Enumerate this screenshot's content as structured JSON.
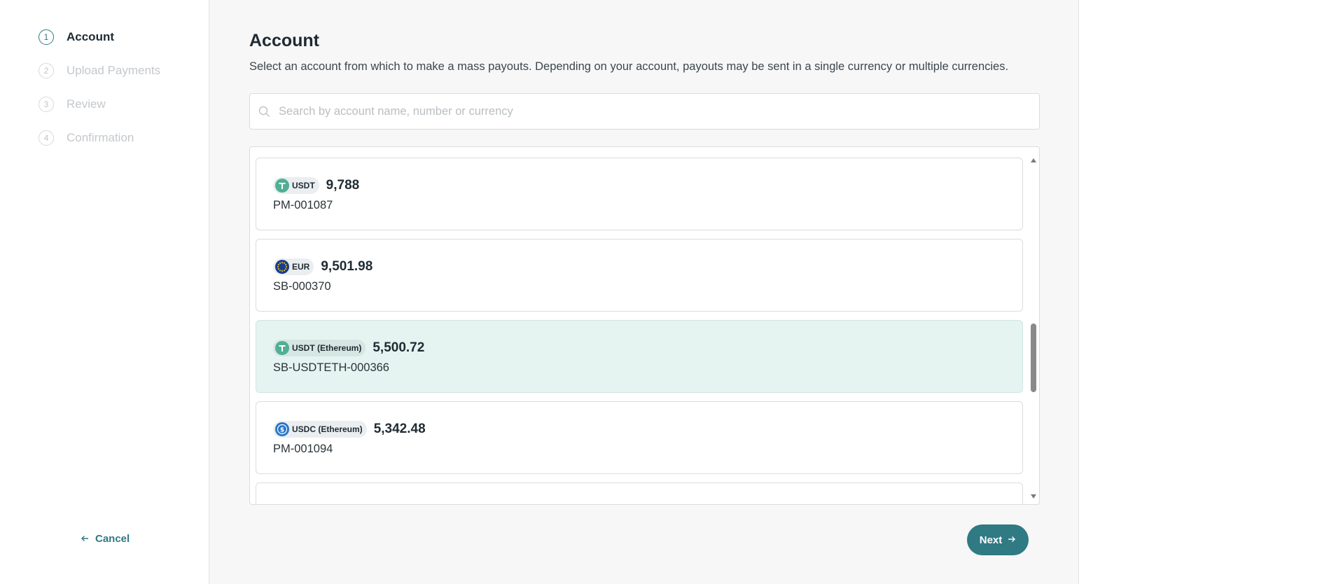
{
  "sidebar": {
    "steps": [
      {
        "num": "1",
        "label": "Account",
        "active": true
      },
      {
        "num": "2",
        "label": "Upload Payments",
        "active": false
      },
      {
        "num": "3",
        "label": "Review",
        "active": false
      },
      {
        "num": "4",
        "label": "Confirmation",
        "active": false
      }
    ],
    "cancel_label": "Cancel"
  },
  "main": {
    "title": "Account",
    "description": "Select an account from which to make a mass payouts. Depending on your account, payouts may be sent in a single currency or multiple currencies.",
    "search": {
      "placeholder": "Search by account name, number or currency",
      "value": ""
    },
    "accounts": [
      {
        "currency": "USDT",
        "icon": "tether-icon",
        "amount": "9,788",
        "account": "PM-001087",
        "selected": false
      },
      {
        "currency": "EUR",
        "icon": "euro-flag-icon",
        "amount": "9,501.98",
        "account": "SB-000370",
        "selected": false
      },
      {
        "currency": "USDT (Ethereum)",
        "icon": "tether-icon",
        "amount": "5,500.72",
        "account": "SB-USDTETH-000366",
        "selected": true
      },
      {
        "currency": "USDC (Ethereum)",
        "icon": "usdc-icon",
        "amount": "5,342.48",
        "account": "PM-001094",
        "selected": false
      }
    ],
    "next_label": "Next"
  },
  "colors": {
    "accent": "#2f7a83",
    "selected_bg": "#e5f4f1",
    "tether": "#50af95",
    "eur_blue": "#1a3d8f",
    "usdc": "#2775ca"
  }
}
